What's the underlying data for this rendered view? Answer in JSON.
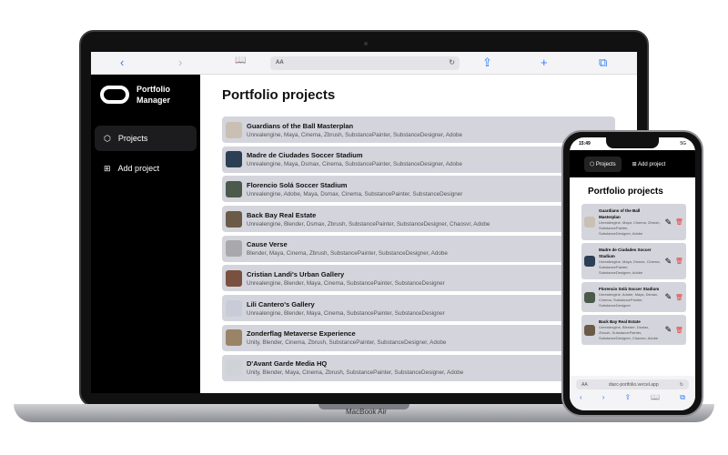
{
  "browser": {
    "address": "AA",
    "back": "‹",
    "forward": "›",
    "bookmarks": "📖",
    "reload": "↻",
    "share": "⇪",
    "new_tab": "+",
    "tabs": "⧉"
  },
  "app": {
    "name_line1": "Portfolio",
    "name_line2": "Manager"
  },
  "nav": [
    {
      "label": "Projects",
      "icon": "cube-icon",
      "glyph": "⬡"
    },
    {
      "label": "Add project",
      "icon": "add-grid-icon",
      "glyph": "⊞"
    }
  ],
  "page_title": "Portfolio projects",
  "projects": [
    {
      "title": "Guardians of the Ball Masterplan",
      "tags": "Unrealengine, Maya, Cinema, Zbrush, SubstancePainter, SubstanceDesigner, Adobe",
      "color": "#c9bfb2"
    },
    {
      "title": "Madre de Ciudades Soccer Stadium",
      "tags": "Unrealengine, Maya, Dsmax, Cinema, SubstancePainter, SubstanceDesigner, Adobe",
      "color": "#2d3f55"
    },
    {
      "title": "Florencio Solá Soccer Stadium",
      "tags": "Unrealengine, Adobe, Maya, Dsmax, Cinema, SubstancePainter, SubstanceDesigner",
      "color": "#4b5a4a"
    },
    {
      "title": "Back Bay Real Estate",
      "tags": "Unrealengine, Blender, Dsmax, Zbrush, SubstancePainter, SubstanceDesigner, Chaosvr, Adobe",
      "color": "#6b5a48"
    },
    {
      "title": "Cause Verse",
      "tags": "Blender, Maya, Cinema, Zbrush, SubstancePainter, SubstanceDesigner, Adobe",
      "color": "#a8a8ad"
    },
    {
      "title": "Cristian Landi's Urban Gallery",
      "tags": "Unrealengine, Blender, Maya, Cinema, SubstancePainter, SubstanceDesigner",
      "color": "#7a5040"
    },
    {
      "title": "Lili Cantero's Gallery",
      "tags": "Unrealengine, Blender, Maya, Cinema, SubstancePainter, SubstanceDesigner",
      "color": "#c8ccd8"
    },
    {
      "title": "Zonderflag Metaverse Experience",
      "tags": "Unity, Blender, Cinema, Zbrush, SubstancePainter, SubstanceDesigner, Adobe",
      "color": "#9a8366"
    },
    {
      "title": "D'Avant Garde Media HQ",
      "tags": "Unity, Blender, Maya, Cinema, Zbrush, SubstancePainter, SubstanceDesigner, Adobe",
      "color": "#d0d3d6"
    }
  ],
  "laptop_label": "MacBook Air",
  "phone": {
    "time": "15:49",
    "signal": "5G",
    "address_aa": "AA",
    "url": "diarc-portfolio.vercel.app",
    "reload": "↻",
    "tools": [
      "‹",
      "›",
      "⇪",
      "📖",
      "⧉"
    ]
  },
  "icons": {
    "edit": "✎",
    "delete": "🗑"
  },
  "colors": {
    "delete": "#e53935",
    "accent": "#2f7cf6"
  }
}
